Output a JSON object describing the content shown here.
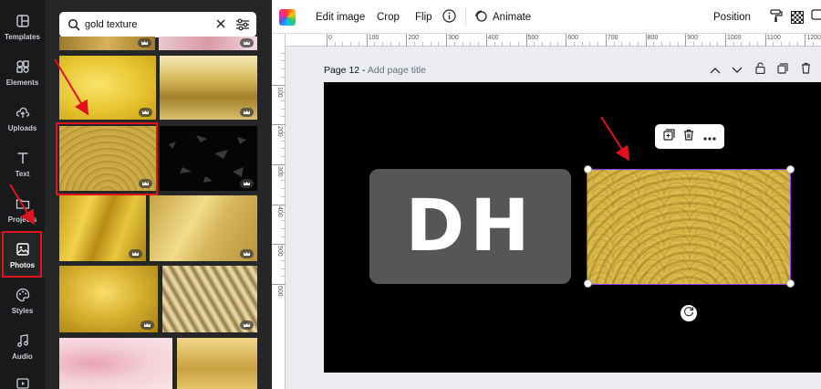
{
  "sidebar": {
    "items": [
      {
        "label": "Templates",
        "icon": "templates-icon"
      },
      {
        "label": "Elements",
        "icon": "elements-icon"
      },
      {
        "label": "Uploads",
        "icon": "upload-icon"
      },
      {
        "label": "Text",
        "icon": "text-icon"
      },
      {
        "label": "Projects",
        "icon": "folder-icon"
      },
      {
        "label": "Photos",
        "icon": "image-icon",
        "active": true
      },
      {
        "label": "Styles",
        "icon": "palette-icon"
      },
      {
        "label": "Audio",
        "icon": "music-note-icon"
      },
      {
        "label": "",
        "icon": "video-icon"
      }
    ]
  },
  "search": {
    "value": "gold texture"
  },
  "toolbar": {
    "edit_image": "Edit image",
    "crop": "Crop",
    "flip": "Flip",
    "animate": "Animate",
    "position": "Position"
  },
  "ruler": {
    "horizontal": [
      "0",
      "100",
      "200",
      "300",
      "400",
      "500",
      "600",
      "700",
      "800",
      "900",
      "1000",
      "1100",
      "1200"
    ],
    "vertical": [
      "100",
      "200",
      "300",
      "400",
      "500",
      "600"
    ]
  },
  "page": {
    "number_label": "Page 12 - ",
    "title_placeholder": "Add page title"
  },
  "canvas": {
    "logo_text": "DH"
  },
  "colors": {
    "accent": "#8b3dff",
    "highlight": "#e0121b",
    "rail_bg": "#18191b",
    "panel_bg": "#252627"
  }
}
